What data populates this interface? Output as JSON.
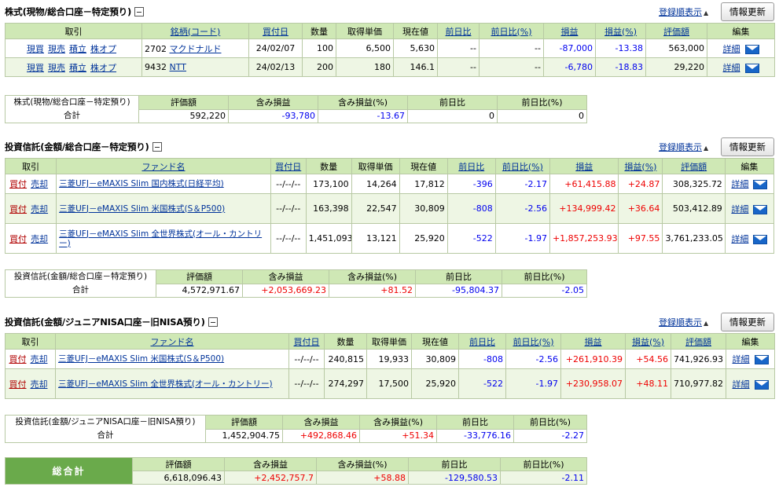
{
  "common": {
    "sort_label": "登録順表示",
    "refresh_label": "情報更新",
    "detail_label": "詳細"
  },
  "stock": {
    "title": "株式(現物/総合口座－特定預り)",
    "headers": [
      "取引",
      "銘柄(コード)",
      "買付日",
      "数量",
      "取得単価",
      "現在値",
      "前日比",
      "前日比(%)",
      "損益",
      "損益(%)",
      "評価額",
      "編集"
    ],
    "actions": [
      "現買",
      "現売",
      "積立",
      "株オプ"
    ],
    "rows": [
      {
        "code": "2702",
        "name": "マクドナルド",
        "date": "24/02/07",
        "qty": "100",
        "cost": "6,500",
        "price": "5,630",
        "chg": "--",
        "chg_pct": "--",
        "pl": "-87,000",
        "pl_pct": "-13.38",
        "value": "563,000"
      },
      {
        "code": "9432",
        "name": "NTT",
        "date": "24/02/13",
        "qty": "200",
        "cost": "180",
        "price": "146.1",
        "chg": "--",
        "chg_pct": "--",
        "pl": "-6,780",
        "pl_pct": "-18.83",
        "value": "29,220"
      }
    ],
    "summary": {
      "label1": "株式(現物/総合口座－特定預り)",
      "label2": "合計",
      "headers": [
        "評価額",
        "含み損益",
        "含み損益(%)",
        "前日比",
        "前日比(%)"
      ],
      "values": [
        "592,220",
        "-93,780",
        "-13.67",
        "0",
        "0"
      ]
    }
  },
  "fund1": {
    "title": "投資信託(金額/総合口座－特定預り)",
    "headers": [
      "取引",
      "ファンド名",
      "買付日",
      "数量",
      "取得単価",
      "現在値",
      "前日比",
      "前日比(%)",
      "損益",
      "損益(%)",
      "評価額",
      "編集"
    ],
    "actions": [
      "買付",
      "売却"
    ],
    "rows": [
      {
        "name": "三菱UFJ－eMAXIS Slim 国内株式(日経平均)",
        "date": "--/--/--",
        "qty": "173,100",
        "cost": "14,264",
        "price": "17,812",
        "chg": "-396",
        "chg_pct": "-2.17",
        "pl": "+61,415.88",
        "pl_pct": "+24.87",
        "value": "308,325.72"
      },
      {
        "name": "三菱UFJ－eMAXIS Slim 米国株式(S＆P500)",
        "date": "--/--/--",
        "qty": "163,398",
        "cost": "22,547",
        "price": "30,809",
        "chg": "-808",
        "chg_pct": "-2.56",
        "pl": "+134,999.42",
        "pl_pct": "+36.64",
        "value": "503,412.89"
      },
      {
        "name": "三菱UFJ－eMAXIS Slim 全世界株式(オール・カントリー)",
        "date": "--/--/--",
        "qty": "1,451,093",
        "cost": "13,121",
        "price": "25,920",
        "chg": "-522",
        "chg_pct": "-1.97",
        "pl": "+1,857,253.93",
        "pl_pct": "+97.55",
        "value": "3,761,233.05"
      }
    ],
    "summary": {
      "label1": "投資信託(金額/総合口座－特定預り)",
      "label2": "合計",
      "headers": [
        "評価額",
        "含み損益",
        "含み損益(%)",
        "前日比",
        "前日比(%)"
      ],
      "values": [
        "4,572,971.67",
        "+2,053,669.23",
        "+81.52",
        "-95,804.37",
        "-2.05"
      ]
    }
  },
  "fund2": {
    "title": "投資信託(金額/ジュニアNISA口座－旧NISA預り)",
    "headers": [
      "取引",
      "ファンド名",
      "買付日",
      "数量",
      "取得単価",
      "現在値",
      "前日比",
      "前日比(%)",
      "損益",
      "損益(%)",
      "評価額",
      "編集"
    ],
    "actions": [
      "買付",
      "売却"
    ],
    "rows": [
      {
        "name": "三菱UFJ－eMAXIS Slim 米国株式(S＆P500)",
        "date": "--/--/--",
        "qty": "240,815",
        "cost": "19,933",
        "price": "30,809",
        "chg": "-808",
        "chg_pct": "-2.56",
        "pl": "+261,910.39",
        "pl_pct": "+54.56",
        "value": "741,926.93"
      },
      {
        "name": "三菱UFJ－eMAXIS Slim 全世界株式(オール・カントリー)",
        "date": "--/--/--",
        "qty": "274,297",
        "cost": "17,500",
        "price": "25,920",
        "chg": "-522",
        "chg_pct": "-1.97",
        "pl": "+230,958.07",
        "pl_pct": "+48.11",
        "value": "710,977.82"
      }
    ],
    "summary": {
      "label1": "投資信託(金額/ジュニアNISA口座－旧NISA預り)",
      "label2": "合計",
      "headers": [
        "評価額",
        "含み損益",
        "含み損益(%)",
        "前日比",
        "前日比(%)"
      ],
      "values": [
        "1,452,904.75",
        "+492,868.46",
        "+51.34",
        "-33,776.16",
        "-2.27"
      ]
    }
  },
  "grand_total": {
    "label": "総合計",
    "headers": [
      "評価額",
      "含み損益",
      "含み損益(%)",
      "前日比",
      "前日比(%)"
    ],
    "values": [
      "6,618,096.43",
      "+2,452,757.7",
      "+58.88",
      "-129,580.53",
      "-2.11"
    ]
  }
}
